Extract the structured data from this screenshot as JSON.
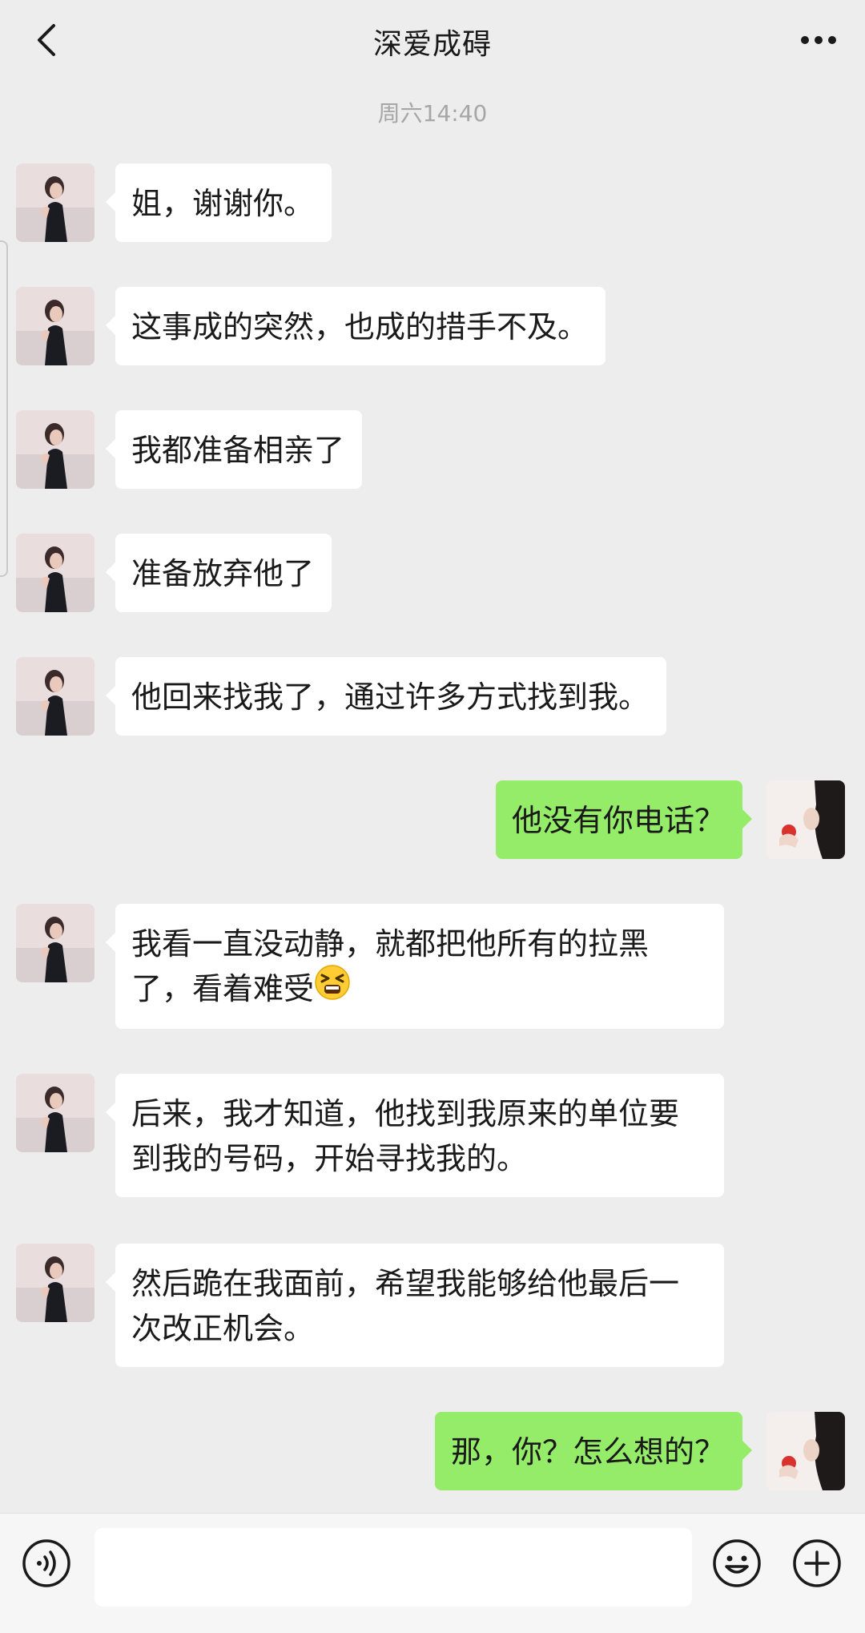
{
  "header": {
    "title": "深爱成碍",
    "back_icon": "chevron-left-icon",
    "more_icon": "more-horizontal-icon"
  },
  "timestamp": "周六14:40",
  "messages": [
    {
      "side": "left",
      "text": "姐，谢谢你。"
    },
    {
      "side": "left",
      "text": "这事成的突然，也成的措手不及。"
    },
    {
      "side": "left",
      "text": "我都准备相亲了"
    },
    {
      "side": "left",
      "text": "准备放弃他了"
    },
    {
      "side": "left",
      "text": "他回来找我了，通过许多方式找到我。"
    },
    {
      "side": "right",
      "text": "他没有你电话？"
    },
    {
      "side": "left",
      "text": "我看一直没动静，就都把他所有的拉黑了，看着难受",
      "emoji": "tired-face-emoji"
    },
    {
      "side": "left",
      "text": "后来，我才知道，他找到我原来的单位要到我的号码，开始寻找我的。"
    },
    {
      "side": "left",
      "text": "然后跪在我面前，希望我能够给他最后一次改正机会。"
    },
    {
      "side": "right",
      "text": "那，你？怎么想的？"
    }
  ],
  "input_bar": {
    "voice_icon": "voice-icon",
    "input_value": "",
    "emoji_icon": "smiley-icon",
    "plus_icon": "plus-circle-icon"
  },
  "colors": {
    "background": "#ededed",
    "incoming_bubble": "#ffffff",
    "outgoing_bubble": "#95ec69",
    "timestamp_text": "#a6a6a6"
  }
}
